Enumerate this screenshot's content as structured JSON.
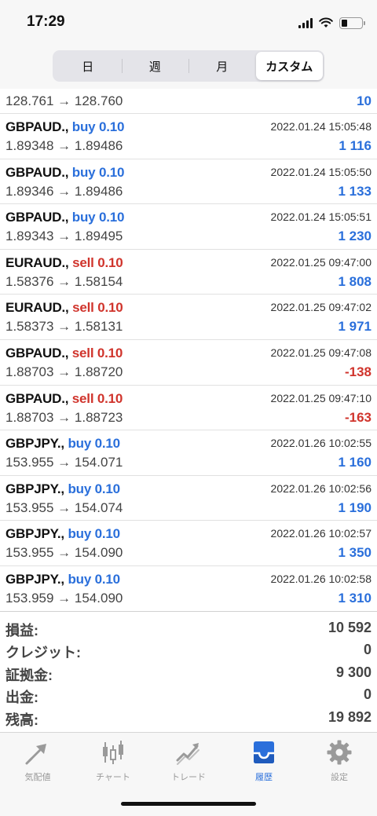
{
  "status": {
    "time": "17:29"
  },
  "tabs_period": [
    {
      "label": "日",
      "active": false
    },
    {
      "label": "週",
      "active": false
    },
    {
      "label": "月",
      "active": false
    },
    {
      "label": "カスタム",
      "active": true
    }
  ],
  "first_row": {
    "prices": "128.761 → 128.760",
    "profit": "10"
  },
  "deals": [
    {
      "symbol": "GBPAUD.,",
      "side": "buy",
      "volume": "buy 0.10",
      "time": "2022.01.24 15:05:48",
      "prices": "1.89348 → 1.89486",
      "profit": "1 116"
    },
    {
      "symbol": "GBPAUD.,",
      "side": "buy",
      "volume": "buy 0.10",
      "time": "2022.01.24 15:05:50",
      "prices": "1.89346 → 1.89486",
      "profit": "1 133"
    },
    {
      "symbol": "GBPAUD.,",
      "side": "buy",
      "volume": "buy 0.10",
      "time": "2022.01.24 15:05:51",
      "prices": "1.89343 → 1.89495",
      "profit": "1 230"
    },
    {
      "symbol": "EURAUD.,",
      "side": "sell",
      "volume": "sell 0.10",
      "time": "2022.01.25 09:47:00",
      "prices": "1.58376 → 1.58154",
      "profit": "1 808"
    },
    {
      "symbol": "EURAUD.,",
      "side": "sell",
      "volume": "sell 0.10",
      "time": "2022.01.25 09:47:02",
      "prices": "1.58373 → 1.58131",
      "profit": "1 971"
    },
    {
      "symbol": "GBPAUD.,",
      "side": "sell",
      "volume": "sell 0.10",
      "time": "2022.01.25 09:47:08",
      "prices": "1.88703 → 1.88720",
      "profit": "-138"
    },
    {
      "symbol": "GBPAUD.,",
      "side": "sell",
      "volume": "sell 0.10",
      "time": "2022.01.25 09:47:10",
      "prices": "1.88703 → 1.88723",
      "profit": "-163"
    },
    {
      "symbol": "GBPJPY.,",
      "side": "buy",
      "volume": "buy 0.10",
      "time": "2022.01.26 10:02:55",
      "prices": "153.955 → 154.071",
      "profit": "1 160"
    },
    {
      "symbol": "GBPJPY.,",
      "side": "buy",
      "volume": "buy 0.10",
      "time": "2022.01.26 10:02:56",
      "prices": "153.955 → 154.074",
      "profit": "1 190"
    },
    {
      "symbol": "GBPJPY.,",
      "side": "buy",
      "volume": "buy 0.10",
      "time": "2022.01.26 10:02:57",
      "prices": "153.955 → 154.090",
      "profit": "1 350"
    },
    {
      "symbol": "GBPJPY.,",
      "side": "buy",
      "volume": "buy 0.10",
      "time": "2022.01.26 10:02:58",
      "prices": "153.959 → 154.090",
      "profit": "1 310"
    }
  ],
  "summary": [
    {
      "label": "損益:",
      "value": "10 592"
    },
    {
      "label": "クレジット:",
      "value": "0"
    },
    {
      "label": "証拠金:",
      "value": "9 300"
    },
    {
      "label": "出金:",
      "value": "0"
    },
    {
      "label": "残高:",
      "value": "19 892"
    }
  ],
  "tabbar": [
    {
      "label": "気配値",
      "icon": "quotes-icon",
      "active": false
    },
    {
      "label": "チャート",
      "icon": "candlestick-chart-icon",
      "active": false
    },
    {
      "label": "トレード",
      "icon": "trade-trend-icon",
      "active": false
    },
    {
      "label": "履歴",
      "icon": "history-inbox-icon",
      "active": true
    },
    {
      "label": "設定",
      "icon": "gear-icon",
      "active": false
    }
  ],
  "colors": {
    "accent": "#2a6fdb",
    "sell": "#d0342c",
    "negative": "#d0342c",
    "inactive": "#9a9a9a"
  }
}
